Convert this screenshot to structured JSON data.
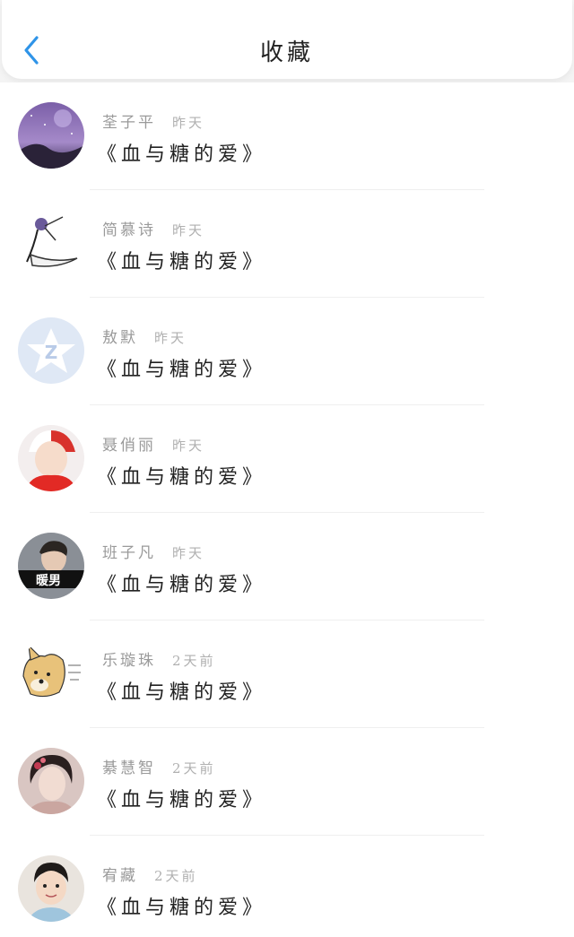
{
  "header": {
    "title": "收藏",
    "back_icon": "chevron-left-icon",
    "accent": "#2f94e8"
  },
  "items": [
    {
      "name": "荃子平",
      "time": "昨天",
      "subject": "《血与糖的爱》",
      "avatar": "galaxy-avatar"
    },
    {
      "name": "简慕诗",
      "time": "昨天",
      "subject": "《血与糖的爱》",
      "avatar": "illustration-avatar"
    },
    {
      "name": "敖默",
      "time": "昨天",
      "subject": "《血与糖的爱》",
      "avatar": "qzone-avatar"
    },
    {
      "name": "聂俏丽",
      "time": "昨天",
      "subject": "《血与糖的爱》",
      "avatar": "anime-avatar"
    },
    {
      "name": "班子凡",
      "time": "昨天",
      "subject": "《血与糖的爱》",
      "avatar": "photo-avatar",
      "avatar_text": "暖男"
    },
    {
      "name": "乐璇珠",
      "time": "2天前",
      "subject": "《血与糖的爱》",
      "avatar": "doge-avatar"
    },
    {
      "name": "綦慧智",
      "time": "2天前",
      "subject": "《血与糖的爱》",
      "avatar": "woman-avatar"
    },
    {
      "name": "宥藏",
      "time": "2天前",
      "subject": "《血与糖的爱》",
      "avatar": "child-avatar"
    }
  ]
}
